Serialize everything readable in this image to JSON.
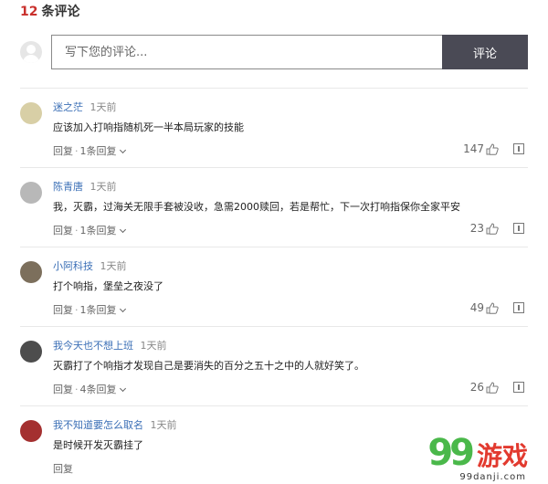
{
  "header": {
    "count": "12",
    "label": "条评论"
  },
  "composer": {
    "placeholder": "写下您的评论...",
    "submit_label": "评论"
  },
  "comments": [
    {
      "user": "迷之茫",
      "time": "1天前",
      "text": "应该加入打响指随机死一半本局玩家的技能",
      "reply_label": "回复",
      "sub_replies": "1条回复",
      "likes": "147"
    },
    {
      "user": "陈青唐",
      "time": "1天前",
      "text": "我，灭霸，过海关无限手套被没收，急需2000赎回，若是帮忙，下一次打响指保你全家平安",
      "reply_label": "回复",
      "sub_replies": "1条回复",
      "likes": "23"
    },
    {
      "user": "小阿科技",
      "time": "1天前",
      "text": "打个响指，堡垒之夜没了",
      "reply_label": "回复",
      "sub_replies": "1条回复",
      "likes": "49"
    },
    {
      "user": "我今天也不想上班",
      "time": "1天前",
      "text": "灭霸打了个响指才发现自己是要消失的百分之五十之中的人就好笑了。",
      "reply_label": "回复",
      "sub_replies": "4条回复",
      "likes": "26"
    },
    {
      "user": "我不知道要怎么取名",
      "time": "1天前",
      "text": "是时候开发灭霸挂了",
      "reply_label": "回复"
    }
  ],
  "watermark": {
    "mark": "99",
    "brand": "游戏",
    "url": "99danji.com"
  },
  "colors": {
    "accent": "#c9302c",
    "username": "#3b6fb6",
    "button": "#4a4a55"
  }
}
